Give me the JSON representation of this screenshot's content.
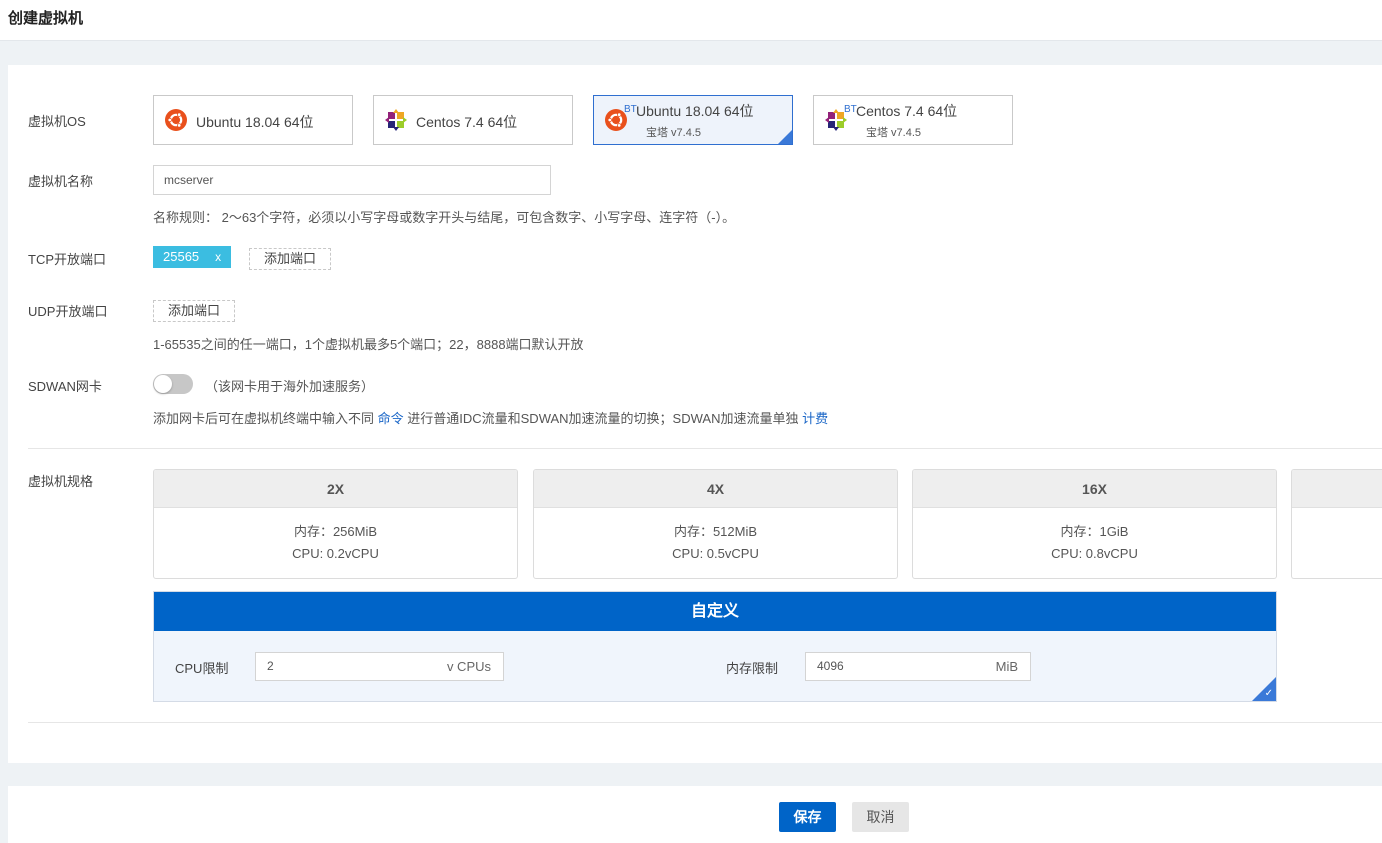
{
  "page": {
    "title": "创建虚拟机"
  },
  "os": {
    "label": "虚拟机OS",
    "options": [
      {
        "name": "Ubuntu 18.04 64位",
        "icon": "ubuntu-icon",
        "badge": "",
        "sub": "",
        "selected": false
      },
      {
        "name": "Centos 7.4 64位",
        "icon": "centos-icon",
        "badge": "",
        "sub": "",
        "selected": false
      },
      {
        "name": "Ubuntu 18.04 64位",
        "icon": "ubuntu-icon",
        "badge": "BT",
        "sub": "宝塔 v7.4.5",
        "selected": true
      },
      {
        "name": "Centos 7.4 64位",
        "icon": "centos-icon",
        "badge": "BT",
        "sub": "宝塔 v7.4.5",
        "selected": false
      }
    ]
  },
  "vm_name": {
    "label": "虚拟机名称",
    "value": "mcserver",
    "hint": "名称规则： 2～63个字符，必须以小写字母或数字开头与结尾，可包含数字、小写字母、连字符（-）。"
  },
  "tcp": {
    "label": "TCP开放端口",
    "ports": [
      "25565"
    ],
    "remove_glyph": "x",
    "add_label": "添加端口"
  },
  "udp": {
    "label": "UDP开放端口",
    "add_label": "添加端口",
    "hint": "1-65535之间的任一端口，1个虚拟机最多5个端口；22，8888端口默认开放"
  },
  "sdwan": {
    "label": "SDWAN网卡",
    "enabled": false,
    "toggle_note": "（该网卡用于海外加速服务）",
    "hint_part1": "添加网卡后可在虚拟机终端中输入不同 ",
    "hint_link1": "命令",
    "hint_part2": " 进行普通IDC流量和SDWAN加速流量的切换；SDWAN加速流量单独 ",
    "hint_link2": "计费"
  },
  "spec": {
    "label": "虚拟机规格",
    "plans": [
      {
        "name": "2X",
        "memory": "内存：256MiB",
        "cpu": "CPU: 0.2vCPU"
      },
      {
        "name": "4X",
        "memory": "内存：512MiB",
        "cpu": "CPU: 0.5vCPU"
      },
      {
        "name": "16X",
        "memory": "内存：1GiB",
        "cpu": "CPU: 0.8vCPU"
      }
    ],
    "custom": {
      "title": "自定义",
      "cpu_label": "CPU限制",
      "cpu_value": "2",
      "cpu_unit": "v CPUs",
      "mem_label": "内存限制",
      "mem_value": "4096",
      "mem_unit": "MiB",
      "check_glyph": "✓"
    }
  },
  "actions": {
    "save": "保存",
    "cancel": "取消"
  },
  "colors": {
    "primary": "#0064c8",
    "tag": "#3bbde1",
    "link": "#1a66c7"
  }
}
